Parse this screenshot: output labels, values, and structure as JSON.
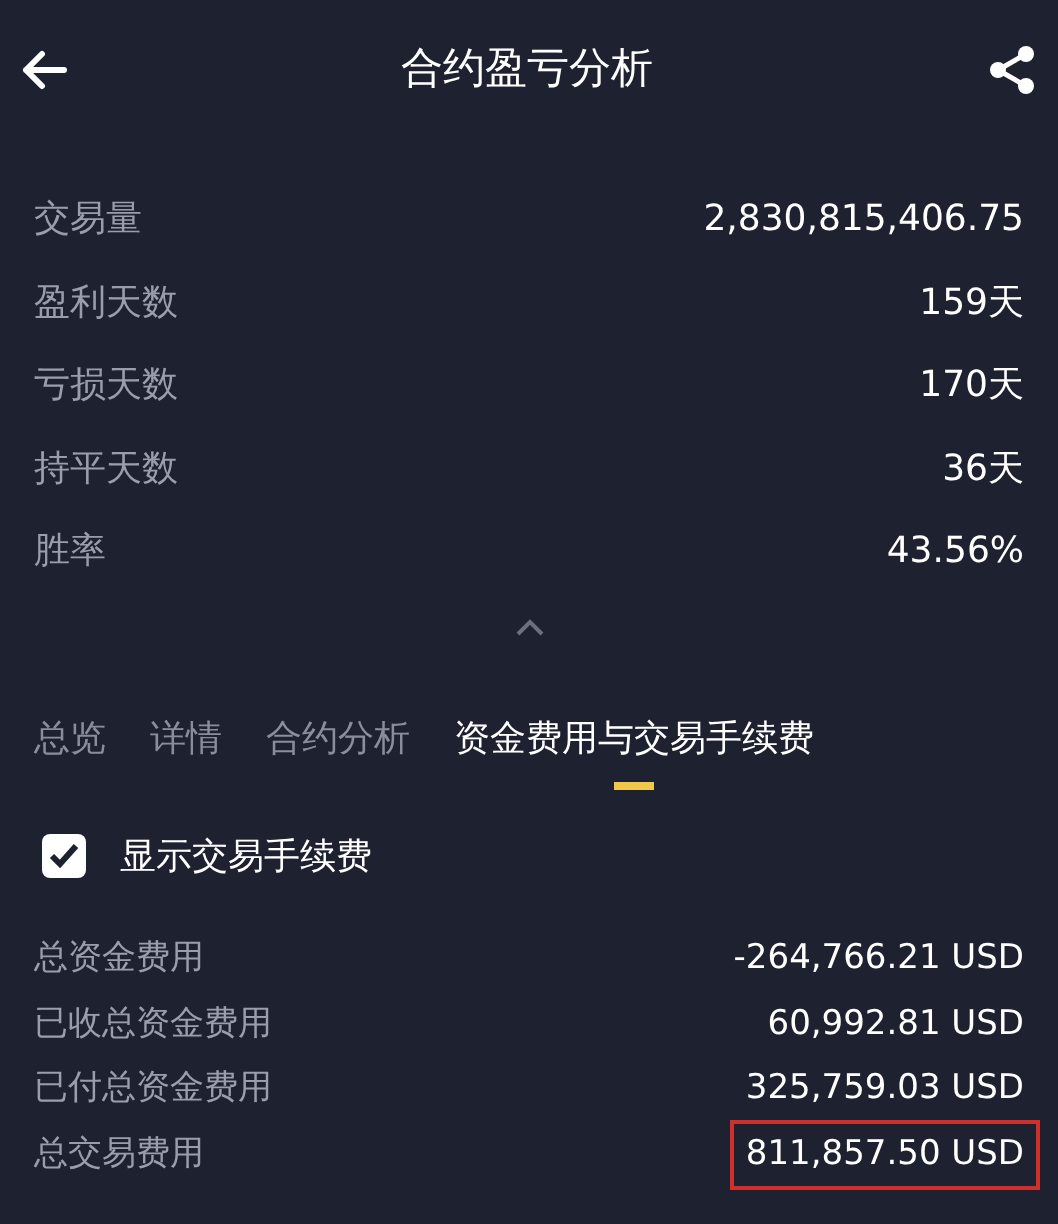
{
  "header": {
    "title": "合约盈亏分析"
  },
  "stats": [
    {
      "label": "交易量",
      "value": "2,830,815,406.75"
    },
    {
      "label": "盈利天数",
      "value": "159天"
    },
    {
      "label": "亏损天数",
      "value": "170天"
    },
    {
      "label": "持平天数",
      "value": "36天"
    },
    {
      "label": "胜率",
      "value": "43.56%"
    }
  ],
  "tabs": [
    {
      "label": "总览",
      "selected": false
    },
    {
      "label": "详情",
      "selected": false
    },
    {
      "label": "合约分析",
      "selected": false
    },
    {
      "label": "资金费用与交易手续费",
      "selected": true
    }
  ],
  "option": {
    "label": "显示交易手续费",
    "checked": true
  },
  "fees": [
    {
      "label": "总资金费用",
      "value": "-264,766.21 USD",
      "highlighted": false
    },
    {
      "label": "已收总资金费用",
      "value": "60,992.81 USD",
      "highlighted": false
    },
    {
      "label": "已付总资金费用",
      "value": "325,759.03 USD",
      "highlighted": false
    },
    {
      "label": "总交易费用",
      "value": "811,857.50 USD",
      "highlighted": true
    }
  ]
}
